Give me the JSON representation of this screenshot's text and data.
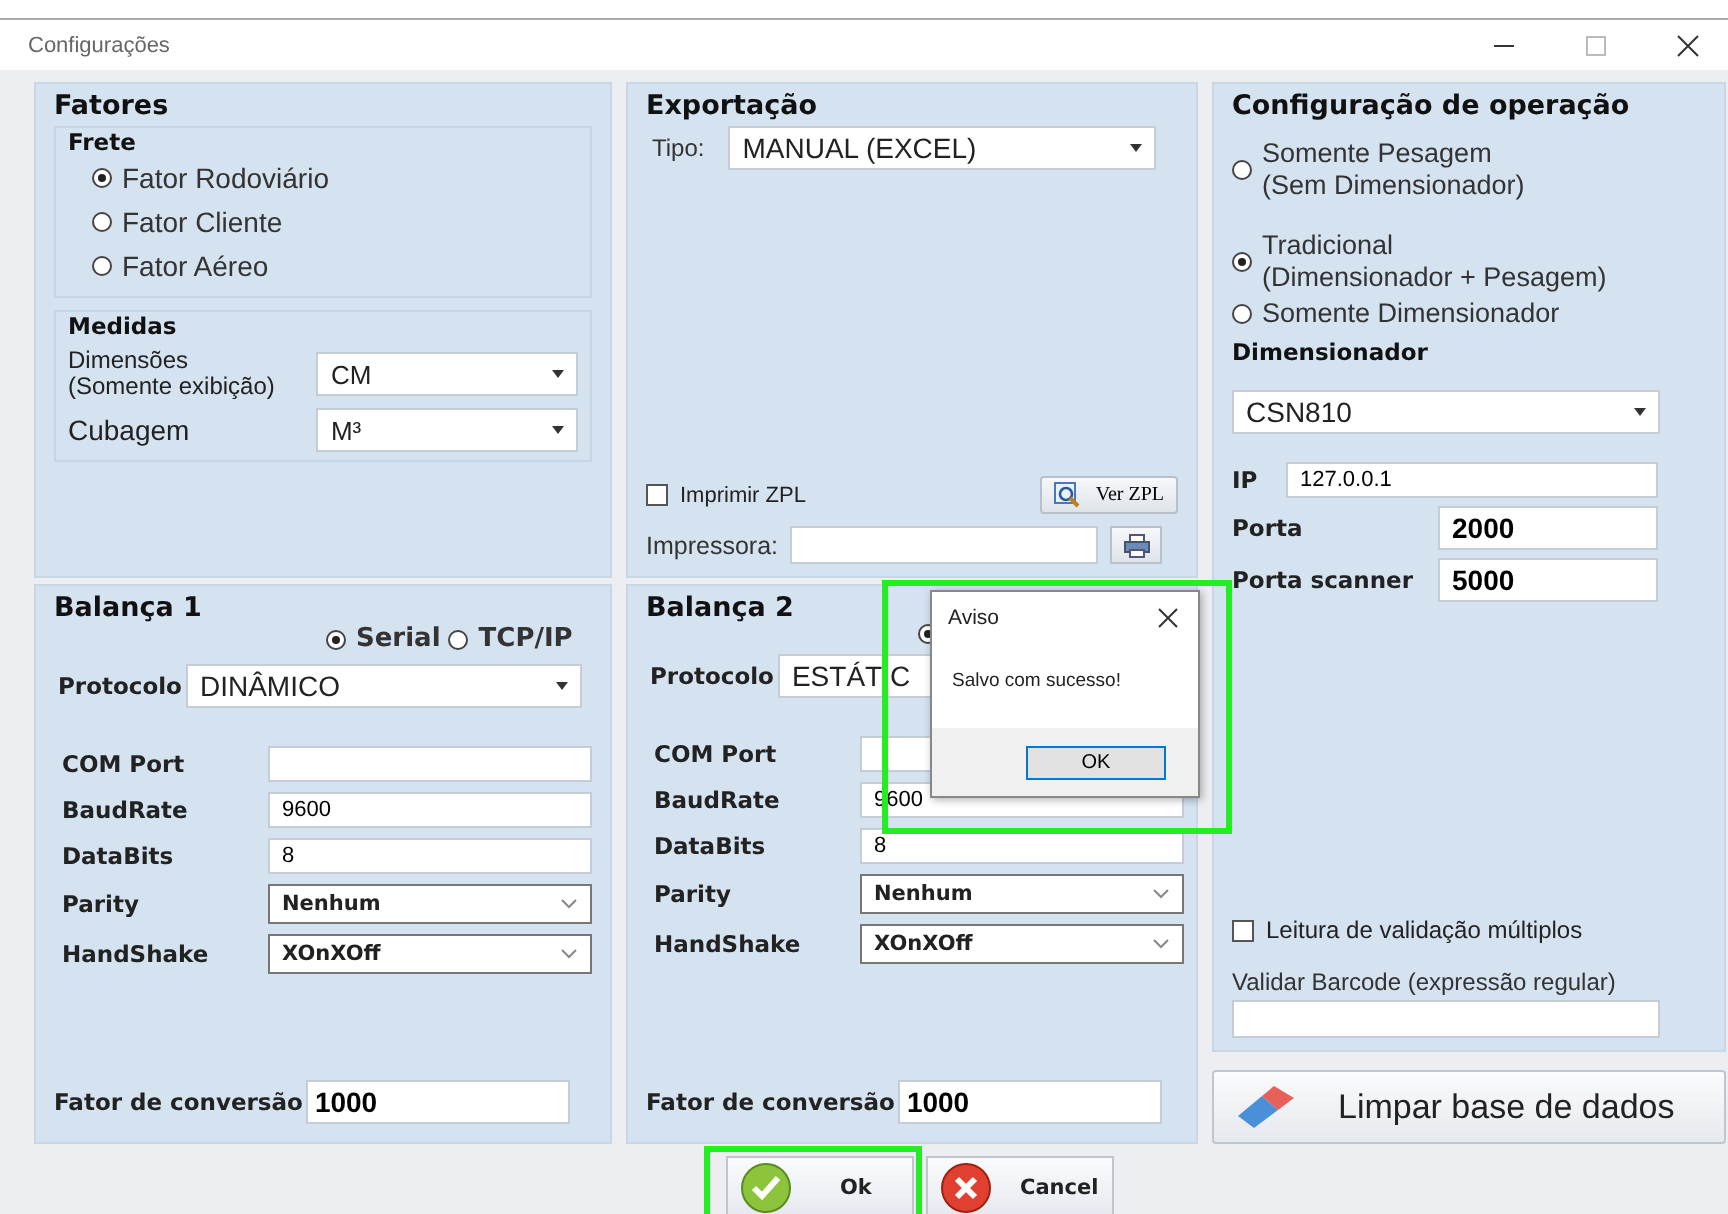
{
  "window": {
    "title": "Configurações"
  },
  "fatores": {
    "title": "Fatores",
    "frete": {
      "title": "Frete",
      "options": [
        {
          "label": "Fator Rodoviário",
          "selected": true
        },
        {
          "label": "Fator Cliente",
          "selected": false
        },
        {
          "label": "Fator Aéreo",
          "selected": false
        }
      ]
    },
    "medidas": {
      "title": "Medidas",
      "fields": [
        {
          "label": "Dimensões\n(Somente exibição)",
          "value": "CM",
          "kind": "small-label"
        },
        {
          "label": "Cubagem",
          "value": "M³",
          "kind": "large-label"
        }
      ]
    }
  },
  "exportacao": {
    "title": "Exportação",
    "tipo": {
      "label": "Tipo:",
      "value": "MANUAL (EXCEL)"
    },
    "imprimir_zpl": {
      "label": "Imprimir ZPL",
      "checked": false
    },
    "ver_zpl_button": "Ver ZPL",
    "impressora": {
      "label": "Impressora:"
    }
  },
  "operacao": {
    "title": "Configuração de operação",
    "modes": [
      {
        "label": "Somente Pesagem\n(Sem Dimensionador)",
        "selected": false
      },
      {
        "label": "Tradicional\n(Dimensionador + Pesagem)",
        "selected": true
      },
      {
        "label": "Somente Dimensionador",
        "selected": false
      }
    ],
    "dimensionador": {
      "title": "Dimensionador",
      "device": "CSN810",
      "fields": [
        {
          "label": "IP",
          "value": "127.0.0.1",
          "kind": "small"
        },
        {
          "label": "Porta",
          "value": "2000",
          "kind": "large"
        },
        {
          "label": "Porta scanner",
          "value": "5000",
          "kind": "large"
        }
      ]
    },
    "leitura": {
      "label": "Leitura de validação múltiplos",
      "checked": false
    },
    "validar_barcode": {
      "label": "Validar Barcode (expressão regular)"
    }
  },
  "limpar_button": "Limpar base de dados",
  "balancas": [
    {
      "title": "Balança 1",
      "connection": [
        {
          "label": "Serial",
          "selected": true
        },
        {
          "label": "TCP/IP",
          "selected": false
        }
      ],
      "protocolo": {
        "label": "Protocolo",
        "value": "DINÂMICO"
      },
      "fields": [
        {
          "label": "COM Port",
          "kind": "text"
        },
        {
          "label": "BaudRate",
          "value": "9600",
          "kind": "text"
        },
        {
          "label": "DataBits",
          "value": "8",
          "kind": "text"
        },
        {
          "label": "Parity",
          "value": "Nenhum",
          "kind": "select"
        },
        {
          "label": "HandShake",
          "value": "XOnXOff",
          "kind": "select"
        }
      ],
      "fator": {
        "label": "Fator de conversão",
        "value": "1000"
      }
    },
    {
      "title": "Balança 2",
      "connection": [
        {
          "selected": true
        }
      ],
      "protocolo": {
        "label": "Protocolo",
        "value": "ESTÁTIC"
      },
      "fields": [
        {
          "label": "COM Port",
          "kind": "text"
        },
        {
          "label": "BaudRate",
          "value": "9600",
          "kind": "text"
        },
        {
          "label": "DataBits",
          "value": "8",
          "kind": "text"
        },
        {
          "label": "Parity",
          "value": "Nenhum",
          "kind": "select"
        },
        {
          "label": "HandShake",
          "value": "XOnXOff",
          "kind": "select"
        }
      ],
      "fator": {
        "label": "Fator de conversão",
        "value": "1000"
      }
    }
  ],
  "buttons": [
    {
      "label": "Ok",
      "kind": "ok"
    },
    {
      "label": "Cancel",
      "kind": "cancel"
    }
  ],
  "dialog": {
    "title": "Aviso",
    "message": "Salvo com sucesso!",
    "button": "OK"
  }
}
